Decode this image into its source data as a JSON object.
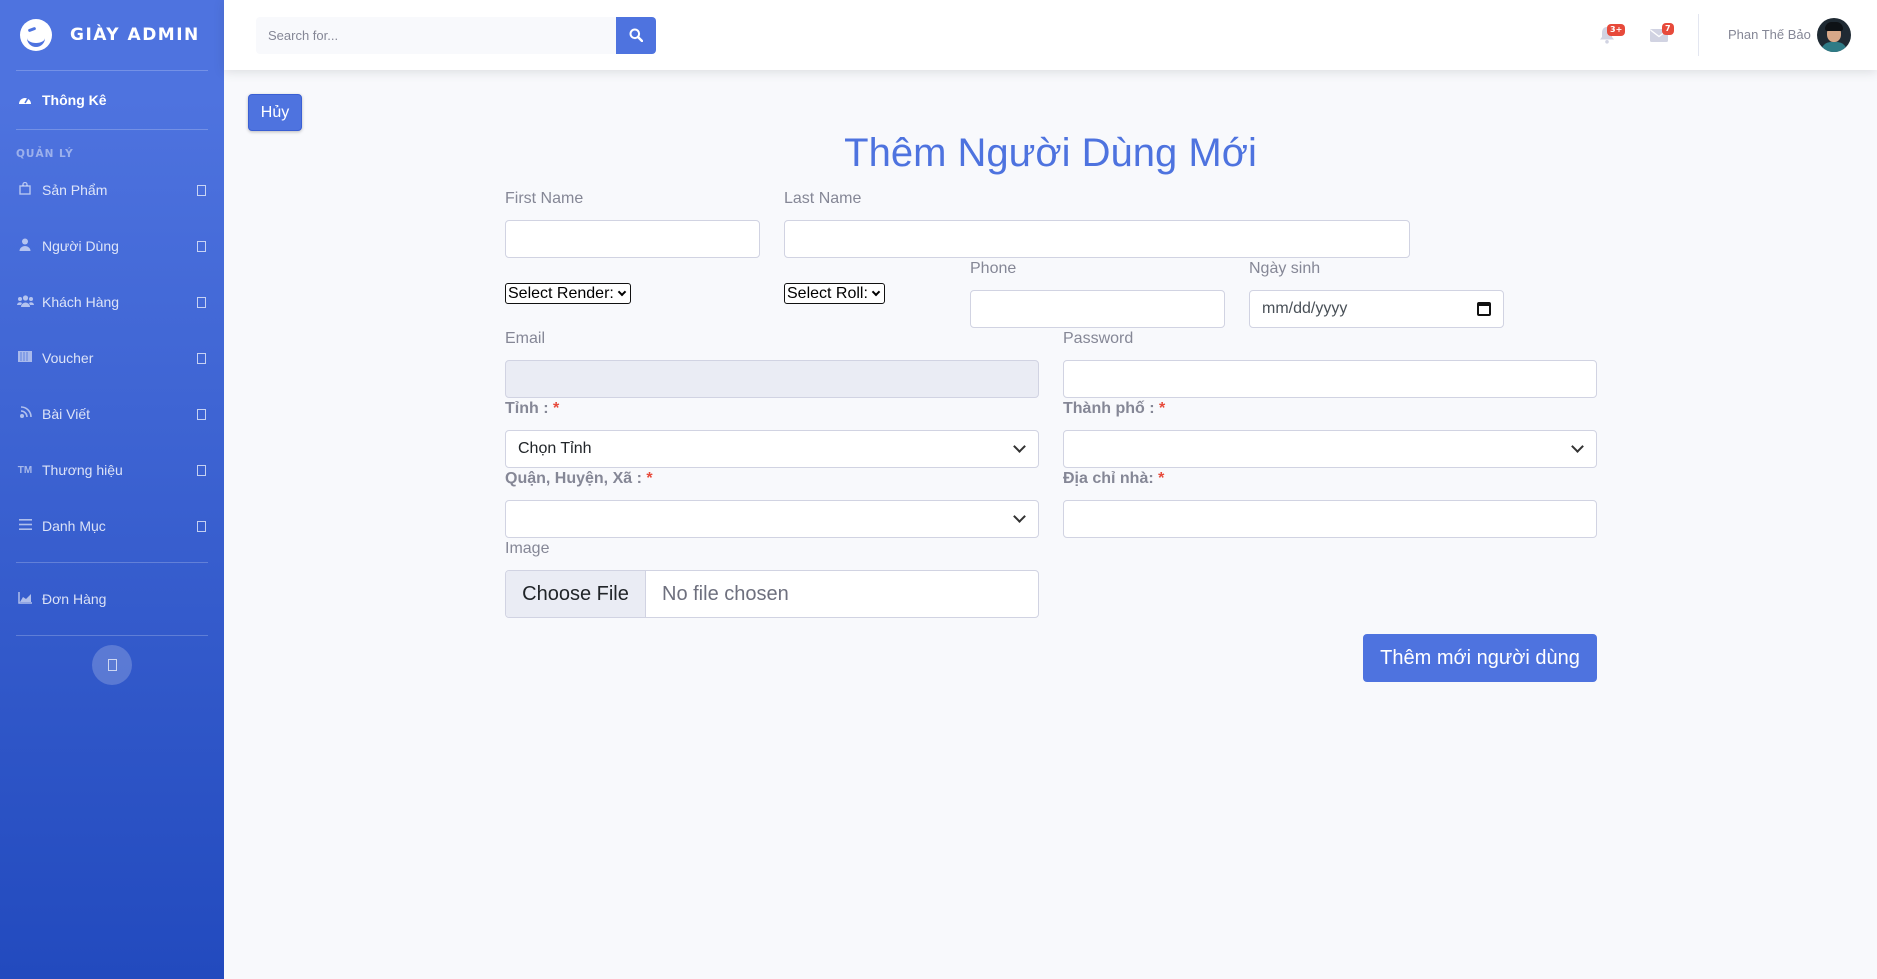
{
  "sidebar": {
    "brand": "GIÀY ADMIN",
    "dashboard": "Thông Kê",
    "section_heading": "QUẢN LÝ",
    "items": [
      {
        "label": "Sản Phẩm",
        "icon": "bag-icon"
      },
      {
        "label": "Người Dùng",
        "icon": "user-icon"
      },
      {
        "label": "Khách Hàng",
        "icon": "users-icon"
      },
      {
        "label": "Voucher",
        "icon": "barcode-icon"
      },
      {
        "label": "Bài Viết",
        "icon": "blog-icon"
      },
      {
        "label": "Thương hiệu",
        "icon": "trademark-icon"
      },
      {
        "label": "Danh Mục",
        "icon": "list-icon"
      }
    ],
    "orders": "Đơn Hàng"
  },
  "topbar": {
    "search_placeholder": "Search for...",
    "alerts_badge": "3+",
    "messages_badge": "7",
    "username": "Phan Thế Bảo"
  },
  "main": {
    "cancel_label": "Hủy",
    "title": "Thêm Người Dùng Mới",
    "first_name_label": "First Name",
    "last_name_label": "Last Name",
    "gender_select": "Select Render:",
    "role_select": "Select Roll:",
    "phone_label": "Phone",
    "birthday_label": "Ngày sinh",
    "birthday_placeholder": "mm/dd/yyyy",
    "email_label": "Email",
    "password_label": "Password",
    "province_label": "Tỉnh :",
    "province_value": "Chọn Tỉnh",
    "city_label": "Thành phố :",
    "district_label": "Quận, Huyện, Xã :",
    "address_label": "Địa chỉ nhà:",
    "required_mark": "*",
    "image_label": "Image",
    "file_button": "Choose File",
    "file_status": "No file chosen",
    "submit_label": "Thêm mới người dùng"
  },
  "colors": {
    "primary": "#4e73df",
    "danger": "#e74a3b",
    "text_muted": "#858796"
  }
}
